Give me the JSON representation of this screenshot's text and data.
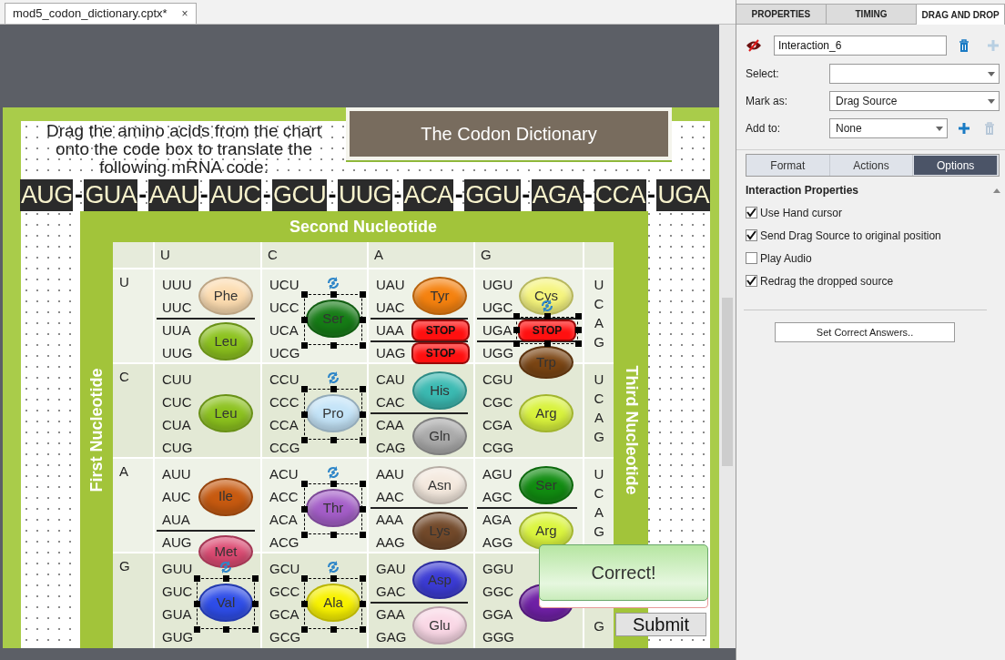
{
  "document_tab": {
    "title": "mod5_codon_dictionary.cptx*",
    "close": "×"
  },
  "slide": {
    "title": "The Codon Dictionary",
    "instructions": "Drag the amino acids from the chart onto the code box to translate the following mRNA code:",
    "mrna": {
      "separator": "-",
      "codons": [
        "AUG",
        "GUA",
        "AAU",
        "AUC",
        "GCU",
        "UUG",
        "ACA",
        "GGU",
        "AGA",
        "CCA",
        "UGA"
      ]
    },
    "chart": {
      "second_label": "Second Nucleotide",
      "first_label": "First Nucleotide",
      "third_label": "Third Nucleotide",
      "columns": [
        "U",
        "C",
        "A",
        "G"
      ],
      "rows": [
        {
          "base": "U",
          "third": [
            "U",
            "C",
            "A",
            "G"
          ],
          "cells": [
            {
              "groups": [
                {
                  "codons": [
                    "UUU",
                    "UUC"
                  ],
                  "amino": {
                    "kind": "amino",
                    "label": "Phe",
                    "color": "#fcdcb0",
                    "selected": false
                  }
                },
                {
                  "codons": [
                    "UUA",
                    "UUG"
                  ],
                  "amino": {
                    "kind": "amino",
                    "label": "Leu",
                    "color": "#8cc21e",
                    "selected": false
                  }
                }
              ]
            },
            {
              "groups": [
                {
                  "codons": [
                    "UCU",
                    "UCC",
                    "UCA",
                    "UCG"
                  ],
                  "amino": {
                    "kind": "amino",
                    "label": "Ser",
                    "color": "#167c16",
                    "selected": true
                  }
                }
              ]
            },
            {
              "groups": [
                {
                  "codons": [
                    "UAU",
                    "UAC"
                  ],
                  "amino": {
                    "kind": "amino",
                    "label": "Tyr",
                    "color": "#f5820f",
                    "selected": false
                  }
                },
                {
                  "codons": [
                    "UAA"
                  ],
                  "amino": {
                    "kind": "stop",
                    "label": "STOP",
                    "color": "#ff1010",
                    "selected": false
                  }
                },
                {
                  "codons": [
                    "UAG"
                  ],
                  "amino": {
                    "kind": "stop",
                    "label": "STOP",
                    "color": "#ff1010",
                    "selected": false
                  }
                }
              ]
            },
            {
              "groups": [
                {
                  "codons": [
                    "UGU",
                    "UGC"
                  ],
                  "amino": {
                    "kind": "amino",
                    "label": "Cys",
                    "color": "#f5f47c",
                    "selected": false
                  }
                },
                {
                  "codons": [
                    "UGA"
                  ],
                  "amino": {
                    "kind": "stop",
                    "label": "STOP",
                    "color": "#ff1010",
                    "selected": true
                  }
                },
                {
                  "codons": [
                    "UGG"
                  ],
                  "amino": {
                    "kind": "amino",
                    "label": "Trp",
                    "color": "#7b4513",
                    "selected": false
                  }
                }
              ]
            }
          ]
        },
        {
          "base": "C",
          "third": [
            "U",
            "C",
            "A",
            "G"
          ],
          "cells": [
            {
              "groups": [
                {
                  "codons": [
                    "CUU",
                    "CUC",
                    "CUA",
                    "CUG"
                  ],
                  "amino": {
                    "kind": "amino",
                    "label": "Leu",
                    "color": "#8cc21e",
                    "selected": false
                  }
                }
              ]
            },
            {
              "groups": [
                {
                  "codons": [
                    "CCU",
                    "CCC",
                    "CCA",
                    "CCG"
                  ],
                  "amino": {
                    "kind": "amino",
                    "label": "Pro",
                    "color": "#c4e4f8",
                    "selected": true
                  }
                }
              ]
            },
            {
              "groups": [
                {
                  "codons": [
                    "CAU",
                    "CAC"
                  ],
                  "amino": {
                    "kind": "amino",
                    "label": "His",
                    "color": "#3bbab2",
                    "selected": false
                  }
                },
                {
                  "codons": [
                    "CAA",
                    "CAG"
                  ],
                  "amino": {
                    "kind": "amino",
                    "label": "Gln",
                    "color": "#aaaaaa",
                    "selected": false
                  }
                }
              ]
            },
            {
              "groups": [
                {
                  "codons": [
                    "CGU",
                    "CGC",
                    "CGA",
                    "CGG"
                  ],
                  "amino": {
                    "kind": "amino",
                    "label": "Arg",
                    "color": "#d8f23c",
                    "selected": false
                  }
                }
              ]
            }
          ]
        },
        {
          "base": "A",
          "third": [
            "U",
            "C",
            "A",
            "G"
          ],
          "cells": [
            {
              "groups": [
                {
                  "codons": [
                    "AUU",
                    "AUC",
                    "AUA"
                  ],
                  "amino": {
                    "kind": "amino",
                    "label": "Ile",
                    "color": "#c75a10",
                    "selected": false
                  }
                },
                {
                  "codons": [
                    "AUG"
                  ],
                  "amino": {
                    "kind": "amino",
                    "label": "Met",
                    "color": "#dc4a72",
                    "selected": false
                  }
                }
              ]
            },
            {
              "groups": [
                {
                  "codons": [
                    "ACU",
                    "ACC",
                    "ACA",
                    "ACG"
                  ],
                  "amino": {
                    "kind": "amino",
                    "label": "Thr",
                    "color": "#a45ec8",
                    "selected": true
                  }
                }
              ]
            },
            {
              "groups": [
                {
                  "codons": [
                    "AAU",
                    "AAC"
                  ],
                  "amino": {
                    "kind": "amino",
                    "label": "Asn",
                    "color": "#f4e9de",
                    "selected": false
                  }
                },
                {
                  "codons": [
                    "AAA",
                    "AAG"
                  ],
                  "amino": {
                    "kind": "amino",
                    "label": "Lys",
                    "color": "#72492a",
                    "selected": false
                  }
                }
              ]
            },
            {
              "groups": [
                {
                  "codons": [
                    "AGU",
                    "AGC"
                  ],
                  "amino": {
                    "kind": "amino",
                    "label": "Ser",
                    "color": "#118c11",
                    "selected": false
                  }
                },
                {
                  "codons": [
                    "AGA",
                    "AGG"
                  ],
                  "amino": {
                    "kind": "amino",
                    "label": "Arg",
                    "color": "#dbf53e",
                    "selected": false
                  }
                }
              ]
            }
          ]
        },
        {
          "base": "G",
          "third": [
            "G"
          ],
          "cells": [
            {
              "groups": [
                {
                  "codons": [
                    "GUU",
                    "GUC",
                    "GUA",
                    "GUG"
                  ],
                  "amino": {
                    "kind": "amino",
                    "label": "Val",
                    "color": "#2e4de8",
                    "selected": true
                  }
                }
              ]
            },
            {
              "groups": [
                {
                  "codons": [
                    "GCU",
                    "GCC",
                    "GCA",
                    "GCG"
                  ],
                  "amino": {
                    "kind": "amino",
                    "label": "Ala",
                    "color": "#f8f200",
                    "selected": true
                  }
                }
              ]
            },
            {
              "groups": [
                {
                  "codons": [
                    "GAU",
                    "GAC"
                  ],
                  "amino": {
                    "kind": "amino",
                    "label": "Asp",
                    "color": "#3b3bd4",
                    "selected": false
                  }
                },
                {
                  "codons": [
                    "GAA",
                    "GAG"
                  ],
                  "amino": {
                    "kind": "amino",
                    "label": "Glu",
                    "color": "#fad8e6",
                    "selected": false
                  }
                }
              ]
            },
            {
              "groups": [
                {
                  "codons": [
                    "GGU",
                    "GGC",
                    "GGA",
                    "GGG"
                  ],
                  "amino": {
                    "kind": "amino",
                    "color": "#6f20a5"
                  }
                }
              ]
            }
          ]
        }
      ]
    },
    "feedback": "Correct!",
    "submit": "Submit"
  },
  "panel": {
    "tabs": [
      {
        "label": "PROPERTIES",
        "selected": false
      },
      {
        "label": "TIMING",
        "selected": false
      },
      {
        "label": "DRAG AND DROP",
        "selected": true
      }
    ],
    "interaction": {
      "name": "Interaction_6",
      "hidden": true
    },
    "fields": [
      {
        "label": "Select:",
        "actions": false
      },
      {
        "label": "Mark as:",
        "value": "Drag Source",
        "actions": false
      },
      {
        "label": "Add to:",
        "value": "None",
        "actions": true
      }
    ],
    "subtabs": [
      {
        "label": "Format",
        "selected": false
      },
      {
        "label": "Actions",
        "selected": false
      },
      {
        "label": "Options",
        "selected": true
      }
    ],
    "section": "Interaction Properties",
    "options": [
      {
        "label": "Use Hand cursor",
        "checked": true
      },
      {
        "label": "Send Drag Source to original position",
        "checked": true
      },
      {
        "label": "Play Audio",
        "checked": false
      },
      {
        "label": "Redrag the dropped source",
        "checked": true
      }
    ],
    "button": "Set Correct Answers.."
  }
}
